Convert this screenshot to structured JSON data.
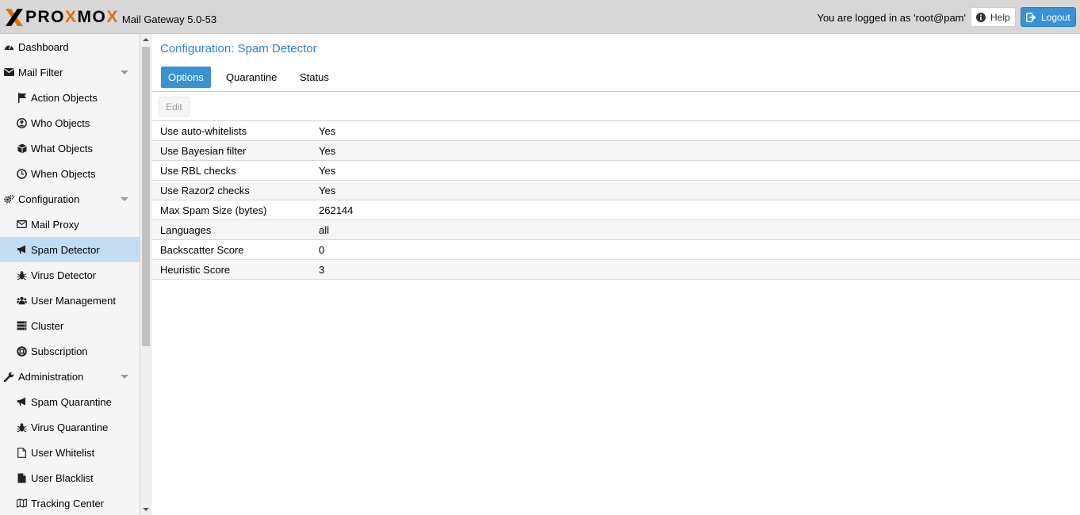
{
  "header": {
    "brand_letters": [
      "PRO",
      "X",
      "MO",
      "X"
    ],
    "product": "Mail Gateway 5.0-53",
    "login_text": "You are logged in as 'root@pam'",
    "help_label": "Help",
    "logout_label": "Logout",
    "colors": {
      "accent": "#3892d4",
      "brand_orange": "#e57000",
      "header_bg": "#d7d7d7"
    }
  },
  "sidebar": {
    "items": [
      {
        "label": "Dashboard",
        "icon": "dashboard-icon",
        "level": 0
      },
      {
        "label": "Mail Filter",
        "icon": "envelope-icon",
        "level": 0,
        "expandable": true
      },
      {
        "label": "Action Objects",
        "icon": "flag-icon",
        "level": 1
      },
      {
        "label": "Who Objects",
        "icon": "user-circle-icon",
        "level": 1
      },
      {
        "label": "What Objects",
        "icon": "cube-icon",
        "level": 1
      },
      {
        "label": "When Objects",
        "icon": "clock-icon",
        "level": 1
      },
      {
        "label": "Configuration",
        "icon": "gears-icon",
        "level": 0,
        "expandable": true
      },
      {
        "label": "Mail Proxy",
        "icon": "envelope-outline-icon",
        "level": 1
      },
      {
        "label": "Spam Detector",
        "icon": "bullhorn-icon",
        "level": 1,
        "selected": true
      },
      {
        "label": "Virus Detector",
        "icon": "bug-icon",
        "level": 1
      },
      {
        "label": "User Management",
        "icon": "users-icon",
        "level": 1
      },
      {
        "label": "Cluster",
        "icon": "server-icon",
        "level": 1
      },
      {
        "label": "Subscription",
        "icon": "life-ring-icon",
        "level": 1
      },
      {
        "label": "Administration",
        "icon": "wrench-icon",
        "level": 0,
        "expandable": true
      },
      {
        "label": "Spam Quarantine",
        "icon": "bullhorn-icon",
        "level": 1
      },
      {
        "label": "Virus Quarantine",
        "icon": "bug-icon",
        "level": 1
      },
      {
        "label": "User Whitelist",
        "icon": "file-outline-icon",
        "level": 1
      },
      {
        "label": "User Blacklist",
        "icon": "file-icon",
        "level": 1
      },
      {
        "label": "Tracking Center",
        "icon": "map-icon",
        "level": 1
      }
    ]
  },
  "main": {
    "title": "Configuration: Spam Detector",
    "tabs": [
      {
        "label": "Options",
        "active": true
      },
      {
        "label": "Quarantine",
        "active": false
      },
      {
        "label": "Status",
        "active": false
      }
    ],
    "toolbar": {
      "edit_label": "Edit"
    },
    "rows": [
      {
        "name": "Use auto-whitelists",
        "value": "Yes"
      },
      {
        "name": "Use Bayesian filter",
        "value": "Yes"
      },
      {
        "name": "Use RBL checks",
        "value": "Yes"
      },
      {
        "name": "Use Razor2 checks",
        "value": "Yes"
      },
      {
        "name": "Max Spam Size (bytes)",
        "value": "262144"
      },
      {
        "name": "Languages",
        "value": "all"
      },
      {
        "name": "Backscatter Score",
        "value": "0"
      },
      {
        "name": "Heuristic Score",
        "value": "3"
      }
    ]
  }
}
